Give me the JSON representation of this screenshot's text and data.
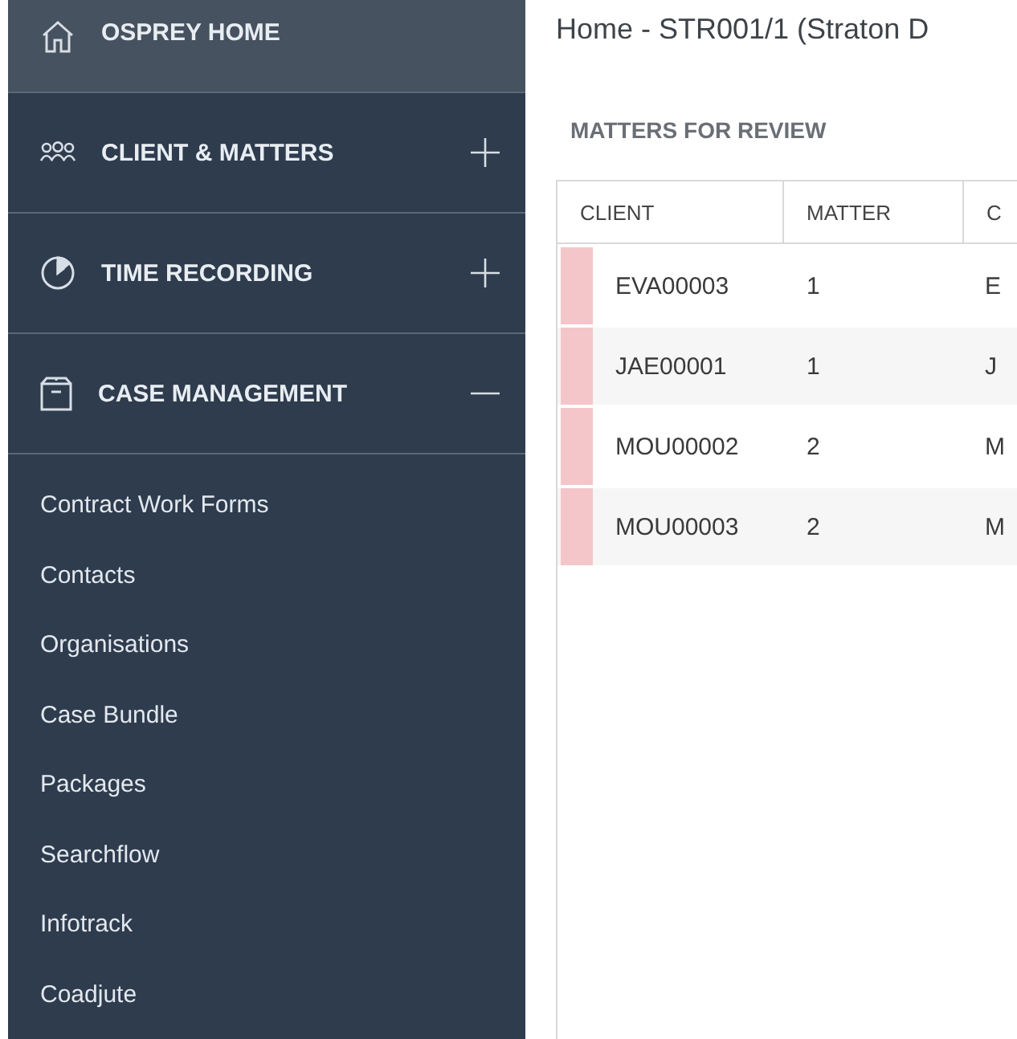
{
  "sidebar": {
    "home": {
      "label": "OSPREY HOME",
      "selected": true
    },
    "groups": [
      {
        "kind": "people",
        "label": "CLIENT & MATTERS",
        "expanded": false,
        "selected": false
      },
      {
        "kind": "clock",
        "label": "TIME RECORDING",
        "expanded": false,
        "selected": false
      },
      {
        "kind": "case",
        "label": "CASE MANAGEMENT",
        "expanded": true,
        "selected": false
      }
    ],
    "items": [
      "Contract Work Forms",
      "Contacts",
      "Organisations",
      "Case Bundle",
      "Packages",
      "Searchflow",
      "Infotrack",
      "Coadjute"
    ]
  },
  "page_title": "Home - STR001/1 (Straton D",
  "section_title": "MATTERS FOR REVIEW",
  "table": {
    "columns": [
      "CLIENT",
      "MATTER",
      "C"
    ],
    "rows": [
      {
        "color": "#f4c6c9",
        "cells": [
          "EVA00003",
          "1",
          "E"
        ]
      },
      {
        "color": "#f4c6c9",
        "cells": [
          "JAE00001",
          "1",
          "J"
        ]
      },
      {
        "color": "#f4c6c9",
        "cells": [
          "MOU00002",
          "2",
          "M"
        ]
      },
      {
        "color": "#f4c6c9",
        "cells": [
          "MOU00003",
          "2",
          "M"
        ]
      }
    ]
  }
}
